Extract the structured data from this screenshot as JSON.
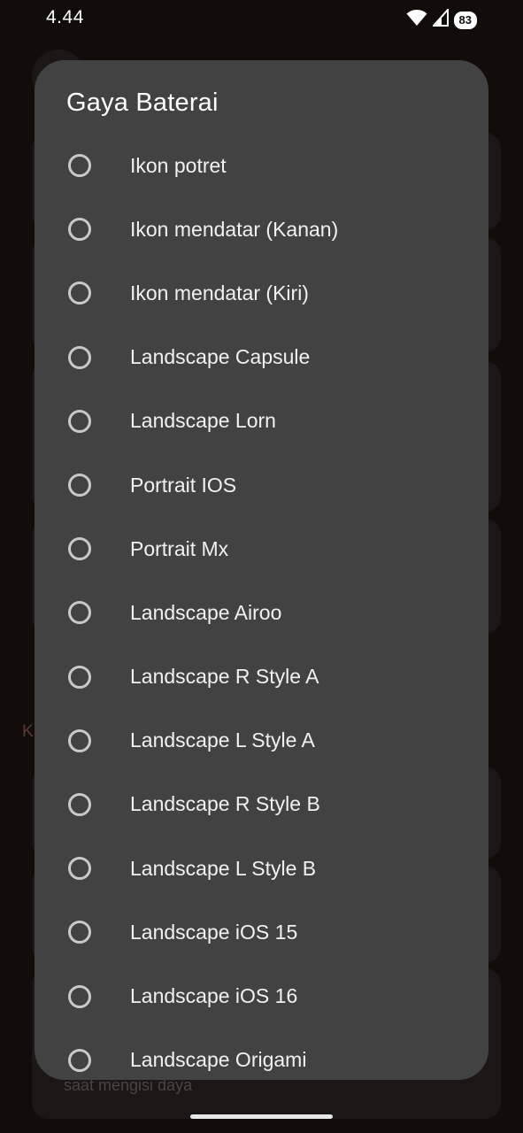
{
  "status_bar": {
    "time": "4.44",
    "battery": "83",
    "icons": [
      "wifi-icon",
      "signal-icon",
      "battery-icon"
    ]
  },
  "background": {
    "partial_letter": "K",
    "subtitle": "saat mengisi daya"
  },
  "dialog": {
    "title": "Gaya Baterai",
    "options": [
      {
        "label": "Ikon potret",
        "selected": false
      },
      {
        "label": "Ikon mendatar (Kanan)",
        "selected": false
      },
      {
        "label": "Ikon mendatar (Kiri)",
        "selected": false
      },
      {
        "label": "Landscape Capsule",
        "selected": false
      },
      {
        "label": "Landscape Lorn",
        "selected": false
      },
      {
        "label": "Portrait IOS",
        "selected": false
      },
      {
        "label": "Portrait Mx",
        "selected": false
      },
      {
        "label": "Landscape Airoo",
        "selected": false
      },
      {
        "label": "Landscape R Style A",
        "selected": false
      },
      {
        "label": "Landscape L Style A",
        "selected": false
      },
      {
        "label": "Landscape R Style B",
        "selected": false
      },
      {
        "label": "Landscape L Style B",
        "selected": false
      },
      {
        "label": "Landscape iOS 15",
        "selected": false
      },
      {
        "label": "Landscape iOS 16",
        "selected": false
      },
      {
        "label": "Landscape Origami",
        "selected": false
      }
    ]
  },
  "colors": {
    "dialog_bg": "#424242",
    "radio_border": "#c9c9c9",
    "screen_bg": "#130d0c"
  }
}
